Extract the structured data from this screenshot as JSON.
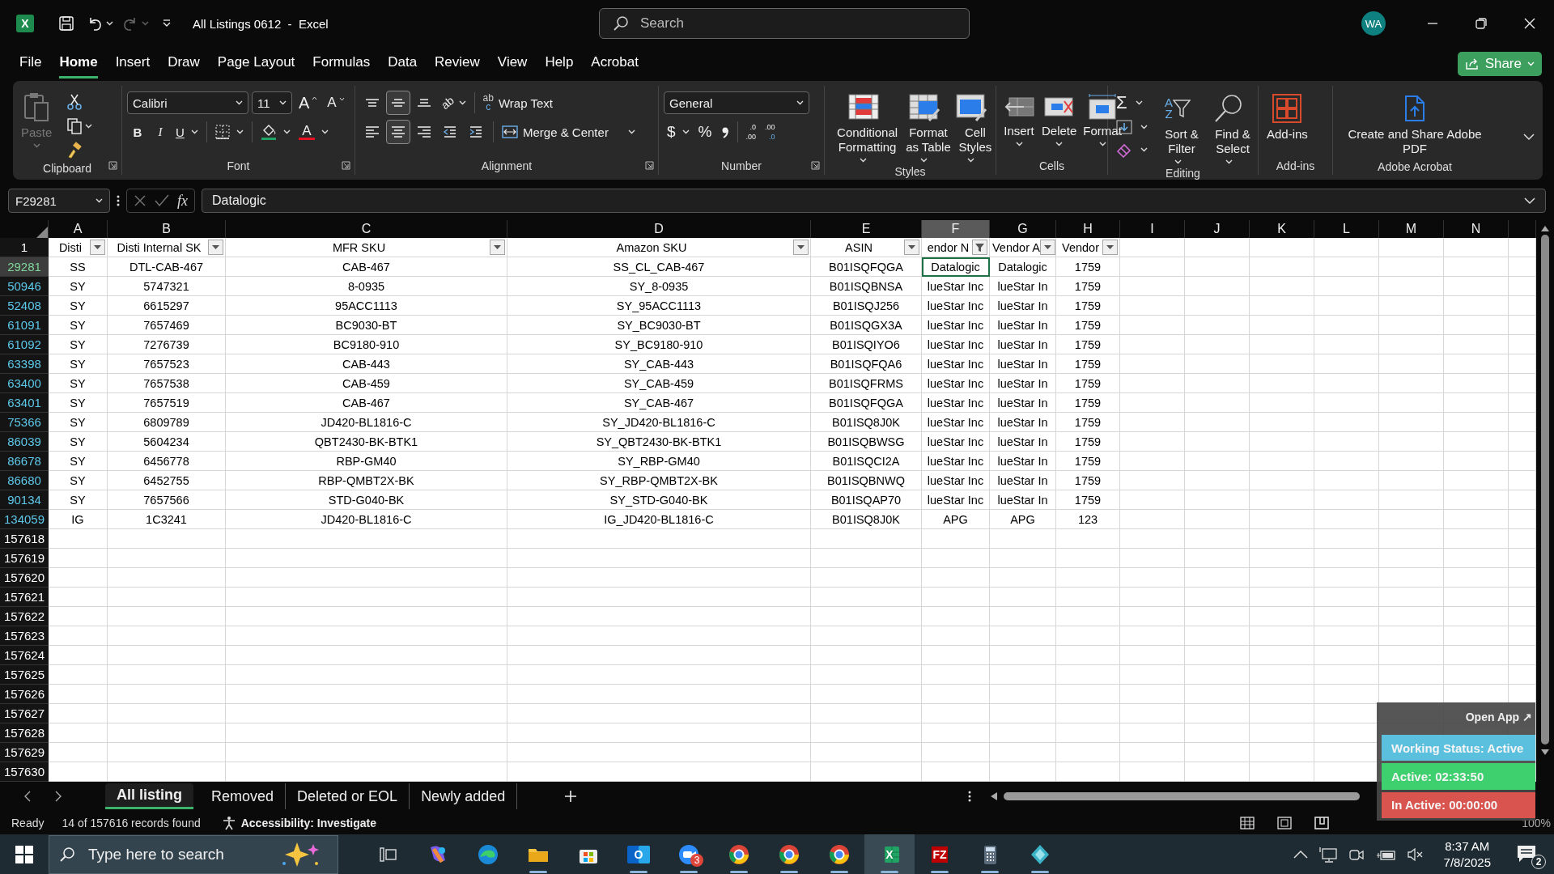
{
  "title_bar": {
    "app_letter": "X",
    "title": "All Listings 0612  -  Excel",
    "search": {
      "placeholder": "Search"
    },
    "avatar": "WA"
  },
  "menu_tabs": [
    {
      "label": "File",
      "selected": false
    },
    {
      "label": "Home",
      "selected": true
    },
    {
      "label": "Insert",
      "selected": false
    },
    {
      "label": "Draw",
      "selected": false
    },
    {
      "label": "Page Layout",
      "selected": false
    },
    {
      "label": "Formulas",
      "selected": false
    },
    {
      "label": "Data",
      "selected": false
    },
    {
      "label": "Review",
      "selected": false
    },
    {
      "label": "View",
      "selected": false
    },
    {
      "label": "Help",
      "selected": false
    },
    {
      "label": "Acrobat",
      "selected": false
    }
  ],
  "share_button": "Share",
  "ribbon": [
    {
      "kind": "clipboard",
      "label": "Clipboard",
      "dialog_launcher": true,
      "paste": "Paste",
      "paste_disabled": true
    },
    {
      "kind": "font",
      "label": "Font",
      "dialog_launcher": true,
      "font_name": "Calibri",
      "font_size": "11",
      "grow": "A",
      "shrink": "A",
      "bold": "B",
      "italic": "I",
      "underline": "U",
      "font_color": "A"
    },
    {
      "kind": "alignment",
      "label": "Alignment",
      "dialog_launcher": true,
      "vertical": [
        {
          "kind": "top",
          "selected": false
        },
        {
          "kind": "middle",
          "selected": true
        },
        {
          "kind": "bottom",
          "selected": false
        }
      ],
      "horizontal": [
        {
          "kind": "left",
          "selected": false
        },
        {
          "kind": "center",
          "selected": true
        },
        {
          "kind": "right",
          "selected": false
        }
      ],
      "orientation_glyph": "ab",
      "wrap_glyph": [
        "ab",
        "c"
      ],
      "wrap_text": "Wrap Text",
      "merge_center": "Merge & Center"
    },
    {
      "kind": "number",
      "label": "Number",
      "dialog_launcher": true,
      "format": "General",
      "currency": "$",
      "percent": "%",
      "increase_decimal": [
        ".0",
        ".00"
      ],
      "decrease_decimal": [
        ".00",
        ".0"
      ]
    },
    {
      "kind": "styles",
      "label": "Styles",
      "dialog_launcher": false,
      "buttons": [
        {
          "kind": "conditional",
          "label": "Conditional Formatting"
        },
        {
          "kind": "table",
          "label": "Format as Table"
        },
        {
          "kind": "cellstyles",
          "label": "Cell Styles"
        }
      ]
    },
    {
      "kind": "cells",
      "label": "Cells",
      "dialog_launcher": false,
      "buttons": [
        {
          "kind": "insert",
          "label": "Insert"
        },
        {
          "kind": "delete",
          "label": "Delete"
        },
        {
          "kind": "format",
          "label": "Format"
        }
      ]
    },
    {
      "kind": "editing",
      "label": "Editing",
      "dialog_launcher": false,
      "autosum": "Σ",
      "sort_letters": [
        "A",
        "Z"
      ],
      "sort_filter": "Sort & Filter",
      "find_select": "Find & Select"
    },
    {
      "kind": "addins",
      "label": "Add-ins",
      "dialog_launcher": false,
      "button": "Add-ins"
    },
    {
      "kind": "acrobat",
      "label": "Adobe Acrobat",
      "dialog_launcher": false,
      "button": "Create and Share Adobe PDF"
    }
  ],
  "formula_bar": {
    "name_box": "F29281",
    "fx": "fx",
    "value": "Datalogic"
  },
  "sheet": {
    "columns": [
      {
        "letter": "A",
        "selected": false
      },
      {
        "letter": "B",
        "selected": false
      },
      {
        "letter": "C",
        "selected": false
      },
      {
        "letter": "D",
        "selected": false
      },
      {
        "letter": "E",
        "selected": false
      },
      {
        "letter": "F",
        "selected": true
      },
      {
        "letter": "G",
        "selected": false
      },
      {
        "letter": "H",
        "selected": false
      },
      {
        "letter": "I",
        "selected": false
      },
      {
        "letter": "J",
        "selected": false
      },
      {
        "letter": "K",
        "selected": false
      },
      {
        "letter": "L",
        "selected": false
      },
      {
        "letter": "M",
        "selected": false
      },
      {
        "letter": "N",
        "selected": false
      }
    ],
    "header_row": {
      "number": "1",
      "cells": [
        {
          "text": "Disti",
          "filtered": false
        },
        {
          "text": "Disti Internal SK",
          "filtered": false
        },
        {
          "text": "MFR SKU",
          "filtered": false
        },
        {
          "text": "Amazon SKU",
          "filtered": false
        },
        {
          "text": "ASIN",
          "filtered": false
        },
        {
          "text": "endor N",
          "filtered": true
        },
        {
          "text": "Vendor A",
          "filtered": false
        },
        {
          "text": "Vendor",
          "filtered": false
        }
      ]
    },
    "rows": [
      {
        "number": "29281",
        "selected": true,
        "cells": [
          "SS",
          "DTL-CAB-467",
          "CAB-467",
          "SS_CL_CAB-467",
          "B01ISQFQGA",
          "Datalogic",
          "Datalogic",
          "1759"
        ]
      },
      {
        "number": "50946",
        "selected": false,
        "cells": [
          "SY",
          "5747321",
          "8-0935",
          "SY_8-0935",
          "B01ISQBNSA",
          "lueStar Inc",
          "lueStar In",
          "1759"
        ]
      },
      {
        "number": "52408",
        "selected": false,
        "cells": [
          "SY",
          "6615297",
          "95ACC1113",
          "SY_95ACC1113",
          "B01ISQJ256",
          "lueStar Inc",
          "lueStar In",
          "1759"
        ]
      },
      {
        "number": "61091",
        "selected": false,
        "cells": [
          "SY",
          "7657469",
          "BC9030-BT",
          "SY_BC9030-BT",
          "B01ISQGX3A",
          "lueStar Inc",
          "lueStar In",
          "1759"
        ]
      },
      {
        "number": "61092",
        "selected": false,
        "cells": [
          "SY",
          "7276739",
          "BC9180-910",
          "SY_BC9180-910",
          "B01ISQIYO6",
          "lueStar Inc",
          "lueStar In",
          "1759"
        ]
      },
      {
        "number": "63398",
        "selected": false,
        "cells": [
          "SY",
          "7657523",
          "CAB-443",
          "SY_CAB-443",
          "B01ISQFQA6",
          "lueStar Inc",
          "lueStar In",
          "1759"
        ]
      },
      {
        "number": "63400",
        "selected": false,
        "cells": [
          "SY",
          "7657538",
          "CAB-459",
          "SY_CAB-459",
          "B01ISQFRMS",
          "lueStar Inc",
          "lueStar In",
          "1759"
        ]
      },
      {
        "number": "63401",
        "selected": false,
        "cells": [
          "SY",
          "7657519",
          "CAB-467",
          "SY_CAB-467",
          "B01ISQFQGA",
          "lueStar Inc",
          "lueStar In",
          "1759"
        ]
      },
      {
        "number": "75366",
        "selected": false,
        "cells": [
          "SY",
          "6809789",
          "JD420-BL1816-C",
          "SY_JD420-BL1816-C",
          "B01ISQ8J0K",
          "lueStar Inc",
          "lueStar In",
          "1759"
        ]
      },
      {
        "number": "86039",
        "selected": false,
        "cells": [
          "SY",
          "5604234",
          "QBT2430-BK-BTK1",
          "SY_QBT2430-BK-BTK1",
          "B01ISQBWSG",
          "lueStar Inc",
          "lueStar In",
          "1759"
        ]
      },
      {
        "number": "86678",
        "selected": false,
        "cells": [
          "SY",
          "6456778",
          "RBP-GM40",
          "SY_RBP-GM40",
          "B01ISQCI2A",
          "lueStar Inc",
          "lueStar In",
          "1759"
        ]
      },
      {
        "number": "86680",
        "selected": false,
        "cells": [
          "SY",
          "6452755",
          "RBP-QMBT2X-BK",
          "SY_RBP-QMBT2X-BK",
          "B01ISQBNWQ",
          "lueStar Inc",
          "lueStar In",
          "1759"
        ]
      },
      {
        "number": "90134",
        "selected": false,
        "cells": [
          "SY",
          "7657566",
          "STD-G040-BK",
          "SY_STD-G040-BK",
          "B01ISQAP70",
          "lueStar Inc",
          "lueStar In",
          "1759"
        ]
      },
      {
        "number": "134059",
        "selected": false,
        "cells": [
          "IG",
          "1C3241",
          "JD420-BL1816-C",
          "IG_JD420-BL1816-C",
          "B01ISQ8J0K",
          "APG",
          "APG",
          "123"
        ]
      }
    ],
    "empty_rows": [
      "157618",
      "157619",
      "157620",
      "157621",
      "157622",
      "157623",
      "157624",
      "157625",
      "157626",
      "157627",
      "157628",
      "157629",
      "157630"
    ]
  },
  "sheet_tabs": [
    {
      "label": "All listing",
      "selected": true
    },
    {
      "label": "Removed",
      "selected": false
    },
    {
      "label": "Deleted or EOL",
      "selected": false
    },
    {
      "label": "Newly added",
      "selected": false
    }
  ],
  "status_bar": {
    "mode": "Ready",
    "records": "14 of 157616 records found",
    "accessibility": "Accessibility: Investigate",
    "zoom": "100%"
  },
  "tracker": {
    "open_app": "Open App ↗",
    "statuses": [
      {
        "text": "Working Status: Active",
        "color": "#5bc0de"
      },
      {
        "text": "Active: 02:33:50",
        "color": "#3ecf6e"
      },
      {
        "text": "In Active: 00:00:00",
        "color": "#d9534f"
      }
    ]
  },
  "taskbar": {
    "search": {
      "placeholder": "Type here to search"
    },
    "apps": [
      {
        "kind": "taskview",
        "running": false,
        "active": false
      },
      {
        "kind": "copilot",
        "running": false,
        "active": false
      },
      {
        "kind": "edge",
        "running": false,
        "active": false
      },
      {
        "kind": "explorer",
        "running": true,
        "active": false
      },
      {
        "kind": "store",
        "running": false,
        "active": false
      },
      {
        "kind": "outlook",
        "running": true,
        "active": false,
        "glyph": "O"
      },
      {
        "kind": "zoom",
        "running": true,
        "active": false,
        "badge": "3"
      },
      {
        "kind": "chrome",
        "running": true,
        "active": false
      },
      {
        "kind": "chrome",
        "running": true,
        "active": false
      },
      {
        "kind": "chrome",
        "running": true,
        "active": false
      },
      {
        "kind": "excel",
        "running": true,
        "active": true,
        "glyph": "X"
      },
      {
        "kind": "filezilla",
        "running": true,
        "active": false,
        "glyph": "FZ"
      },
      {
        "kind": "calculator",
        "running": true,
        "active": false
      },
      {
        "kind": "diamond",
        "running": true,
        "active": false
      }
    ],
    "time": "8:37 AM",
    "date": "7/8/2025",
    "notifications": "2"
  }
}
